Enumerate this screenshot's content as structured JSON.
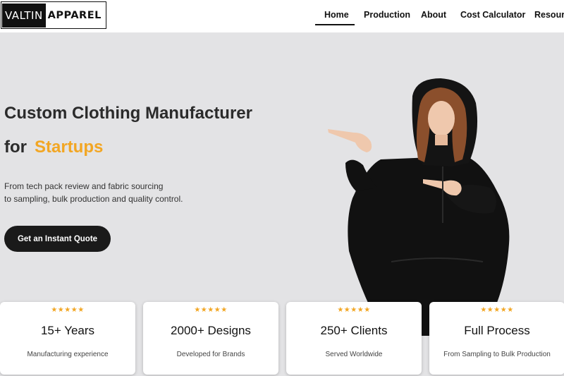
{
  "brand": {
    "logo_left": "VALTIN",
    "logo_right": "APPAREL"
  },
  "nav": {
    "items": [
      {
        "label": "Home",
        "active": true
      },
      {
        "label": "Production",
        "active": false
      },
      {
        "label": "About",
        "active": false
      },
      {
        "label": "Cost Calculator",
        "active": false
      },
      {
        "label": "Resources",
        "active": false
      }
    ]
  },
  "hero": {
    "title": "Custom Clothing Manufacturer",
    "title_prefix": "for",
    "title_accent": "Startups",
    "description_line1": "From tech pack review and fabric sourcing",
    "description_line2": "to sampling, bulk production and quality control.",
    "cta_label": "Get an Instant Quote"
  },
  "stats": [
    {
      "stars": "★★★★★",
      "title": "15+ Years",
      "subtitle": "Manufacturing experience"
    },
    {
      "stars": "★★★★★",
      "title": "2000+ Designs",
      "subtitle": "Developed for Brands"
    },
    {
      "stars": "★★★★★",
      "title": "250+ Clients",
      "subtitle": "Served Worldwide"
    },
    {
      "stars": "★★★★★",
      "title": "Full Process",
      "subtitle": "From Sampling to Bulk Production"
    }
  ],
  "colors": {
    "accent": "#f2a623",
    "hero_bg": "#e3e3e5",
    "dark": "#1a1a1a"
  }
}
